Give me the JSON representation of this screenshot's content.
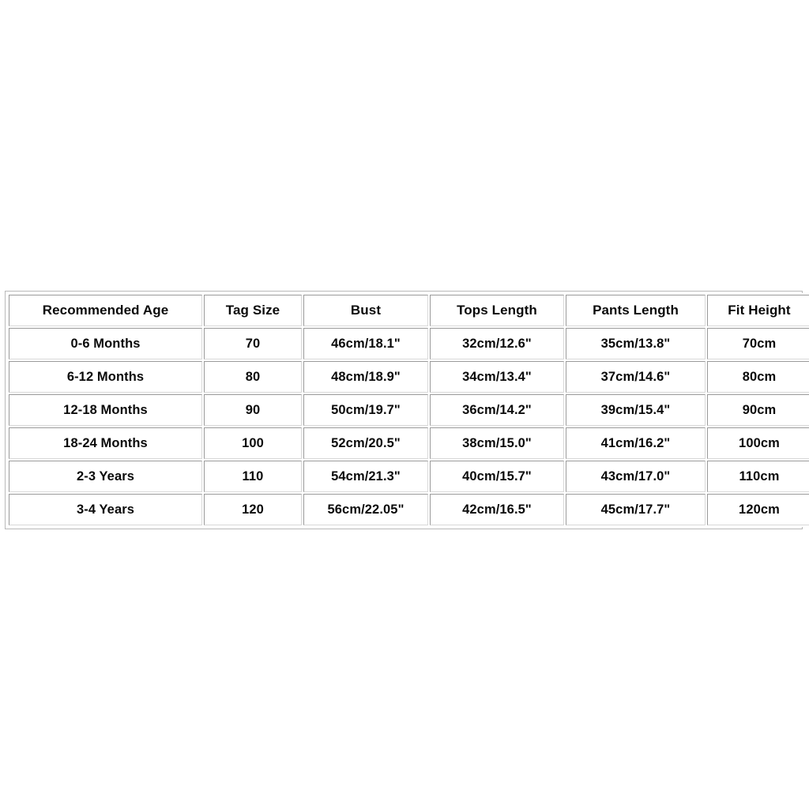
{
  "chart_data": {
    "type": "table",
    "title": "",
    "columns": [
      "Recommended Age",
      "Tag Size",
      "Bust",
      "Tops Length",
      "Pants Length",
      "Fit Height"
    ],
    "rows": [
      [
        "0-6 Months",
        "70",
        "46cm/18.1\"",
        "32cm/12.6\"",
        "35cm/13.8\"",
        "70cm"
      ],
      [
        "6-12 Months",
        "80",
        "48cm/18.9\"",
        "34cm/13.4\"",
        "37cm/14.6\"",
        "80cm"
      ],
      [
        "12-18 Months",
        "90",
        "50cm/19.7\"",
        "36cm/14.2\"",
        "39cm/15.4\"",
        "90cm"
      ],
      [
        "18-24 Months",
        "100",
        "52cm/20.5\"",
        "38cm/15.0\"",
        "41cm/16.2\"",
        "100cm"
      ],
      [
        "2-3 Years",
        "110",
        "54cm/21.3\"",
        "40cm/15.7\"",
        "43cm/17.0\"",
        "110cm"
      ],
      [
        "3-4 Years",
        "120",
        "56cm/22.05\"",
        "42cm/16.5\"",
        "45cm/17.7\"",
        "120cm"
      ]
    ]
  },
  "colors": {
    "page_background": "#ffffff",
    "cell_background": "#ffffff",
    "text": "#0a0a0a",
    "border_dark": "#9a9a9a",
    "border_light": "#d8d8d8",
    "outer_border": "#b9b9b9"
  }
}
